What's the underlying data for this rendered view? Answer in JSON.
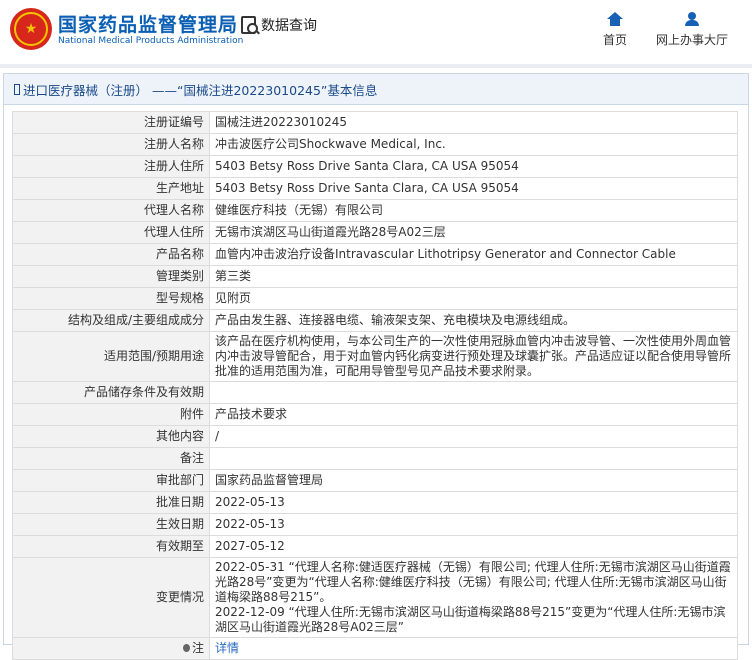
{
  "header": {
    "brand_cn": "国家药品监督管理局",
    "brand_en": "National Medical Products Administration",
    "search_label": "数据查询",
    "nav": [
      {
        "icon": "home-icon",
        "label": "首页"
      },
      {
        "icon": "user-icon",
        "label": "网上办事大厅"
      }
    ]
  },
  "panel": {
    "title": "进口医疗器械（注册） ——“国械注进20223010245”基本信息"
  },
  "rows": [
    {
      "key": "注册证编号",
      "value": "国械注进20223010245"
    },
    {
      "key": "注册人名称",
      "value": "冲击波医疗公司Shockwave Medical, Inc."
    },
    {
      "key": "注册人住所",
      "value": "5403 Betsy Ross Drive Santa Clara, CA USA 95054"
    },
    {
      "key": "生产地址",
      "value": "5403 Betsy Ross Drive Santa Clara, CA USA 95054"
    },
    {
      "key": "代理人名称",
      "value": "健维医疗科技（无锡）有限公司"
    },
    {
      "key": "代理人住所",
      "value": "无锡市滨湖区马山街道霞光路28号A02三层"
    },
    {
      "key": "产品名称",
      "value": "血管内冲击波治疗设备Intravascular Lithotripsy Generator and Connector Cable"
    },
    {
      "key": "管理类别",
      "value": "第三类"
    },
    {
      "key": "型号规格",
      "value": "见附页"
    },
    {
      "key": "结构及组成/主要组成成分",
      "value": "产品由发生器、连接器电缆、输液架支架、充电模块及电源线组成。"
    },
    {
      "key": "适用范围/预期用途",
      "value": "该产品在医疗机构使用，与本公司生产的一次性使用冠脉血管内冲击波导管、一次性使用外周血管内冲击波导管配合，用于对血管内钙化病变进行预处理及球囊扩张。产品适应证以配合使用导管所批准的适用范围为准，可配用导管型号见产品技术要求附录。"
    },
    {
      "key": "产品储存条件及有效期",
      "value": ""
    },
    {
      "key": "附件",
      "value": "产品技术要求"
    },
    {
      "key": "其他内容",
      "value": "/"
    },
    {
      "key": "备注",
      "value": ""
    },
    {
      "key": "审批部门",
      "value": "国家药品监督管理局"
    },
    {
      "key": "批准日期",
      "value": "2022-05-13"
    },
    {
      "key": "生效日期",
      "value": "2022-05-13"
    },
    {
      "key": "有效期至",
      "value": "2027-05-12"
    },
    {
      "key": "变更情况",
      "value": "2022-05-31 “代理人名称:健适医疗器械（无锡）有限公司; 代理人住所:无锡市滨湖区马山街道霞光路28号”变更为“代理人名称:健维医疗科技（无锡）有限公司; 代理人住所:无锡市滨湖区马山街道梅梁路88号215”。\n2022-12-09 “代理人住所:无锡市滨湖区马山街道梅梁路88号215”变更为“代理人住所:无锡市滨湖区马山街道霞光路28号A02三层”"
    }
  ],
  "note": {
    "key": "注",
    "link": "详情"
  },
  "colors": {
    "brand_blue": "#0a5fb4",
    "logo_red": "#d7261b",
    "link_blue": "#2a6bbf"
  }
}
